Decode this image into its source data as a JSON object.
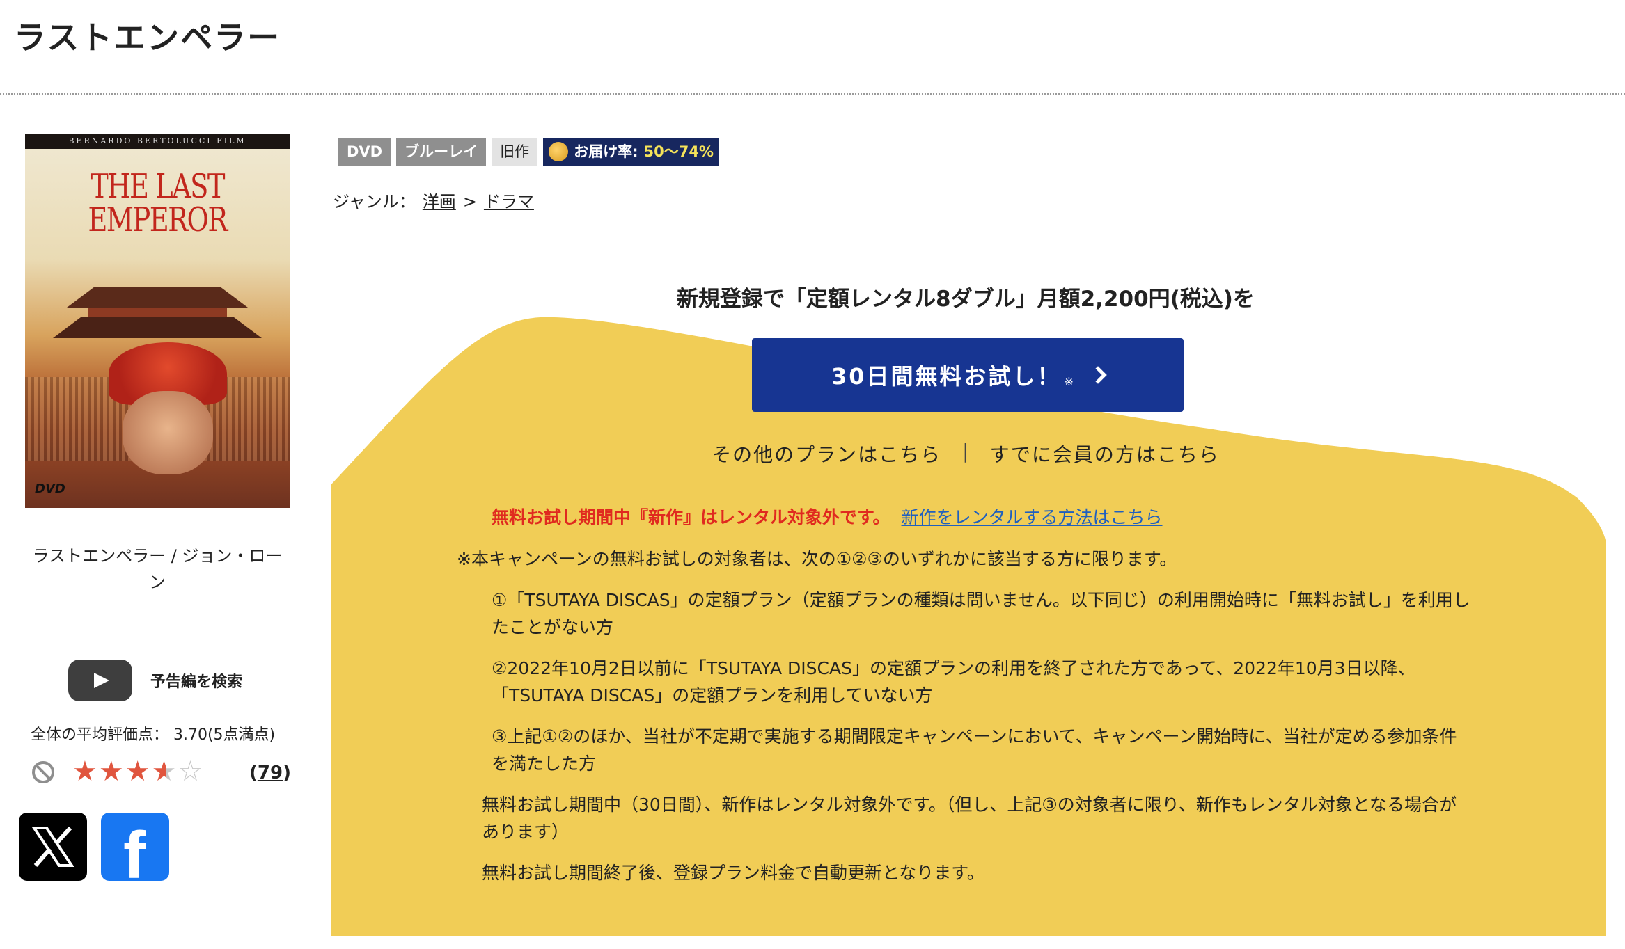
{
  "page": {
    "title": "ラストエンペラー"
  },
  "poster": {
    "band": "BERNARDO BERTOLUCCI FILM",
    "title_line1": "THE LAST",
    "title_line2": "EMPEROR",
    "format_mark": "DVD"
  },
  "product": {
    "caption": "ラストエンペラー / ジョン・ローン"
  },
  "trailer": {
    "label": "予告編を検索",
    "icon": "play-icon"
  },
  "rating": {
    "average_text": "全体の平均評価点： 3.70(5点満点)",
    "score": 3.7,
    "max": 5,
    "review_count_open": "(",
    "review_count": "79",
    "review_count_close": ")"
  },
  "social": {
    "x_label": "X",
    "facebook_label": "f"
  },
  "tags": {
    "dvd": "DVD",
    "bluray": "ブルーレイ",
    "old": "旧作",
    "delivery_label": "お届け率:",
    "delivery_value": "50〜74%"
  },
  "genre": {
    "label": "ジャンル：",
    "crumb1": "洋画",
    "separator": ">",
    "crumb2": "ドラマ"
  },
  "promo": {
    "headline": "新規登録で「定額レンタル8ダブル」月額2,200円(税込)を",
    "cta_label": "30日間無料お試し！",
    "cta_note": "※",
    "other_plans": "その他のプランはこちら",
    "separator": "|",
    "member_login": "すでに会員の方はこちら",
    "notice_red": "無料お試し期間中『新作』はレンタル対象外です。",
    "notice_link": "新作をレンタルする方法はこちら",
    "colors": {
      "yellow": "#f1cd56",
      "button": "#173592",
      "alert": "#e02a1f",
      "link": "#1f5fbf"
    }
  },
  "terms": {
    "intro": "※本キャンペーンの無料お試しの対象者は、次の①②③のいずれかに該当する方に限ります。",
    "item1": "①「TSUTAYA DISCAS」の定額プラン（定額プランの種類は問いません。以下同じ）の利用開始時に「無料お試し」を利用したことがない方",
    "item2": "②2022年10月2日以前に「TSUTAYA DISCAS」の定額プランの利用を終了された方であって、2022年10月3日以降、「TSUTAYA DISCAS」の定額プランを利用していない方",
    "item3": "③上記①②のほか、当社が不定期で実施する期間限定キャンペーンにおいて、キャンペーン開始時に、当社が定める参加条件を満たした方",
    "note1": "無料お試し期間中（30日間）、新作はレンタル対象外です。（但し、上記③の対象者に限り、新作もレンタル対象となる場合があります）",
    "note2": "無料お試し期間終了後、登録プラン料金で自動更新となります。"
  }
}
